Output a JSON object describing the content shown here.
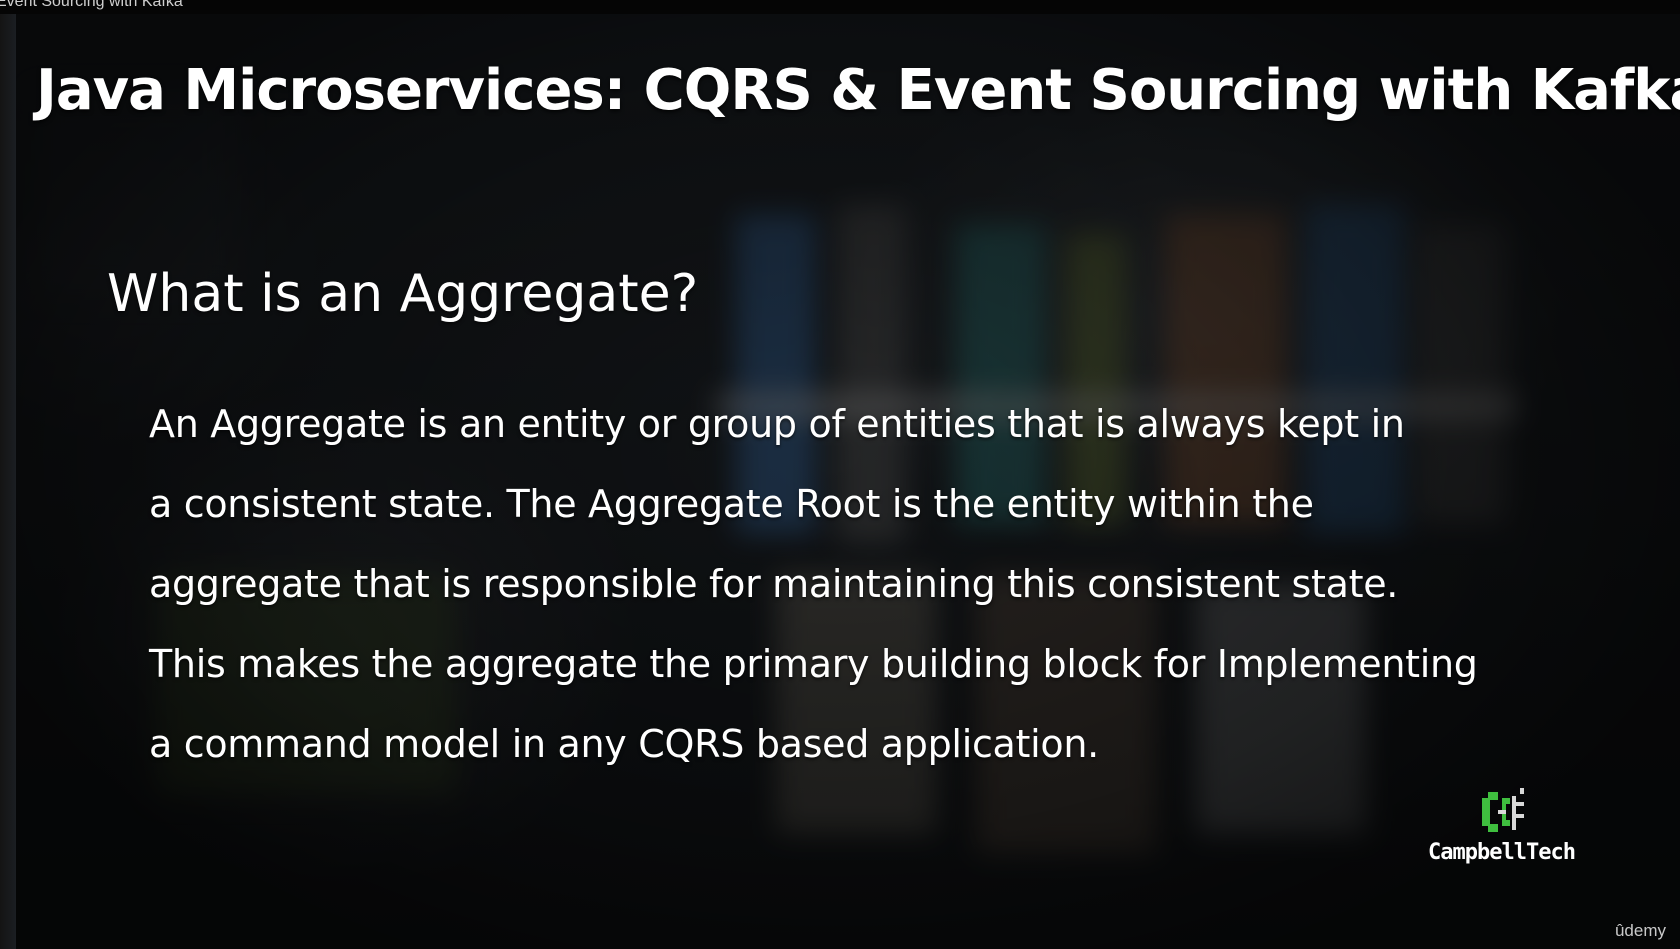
{
  "window": {
    "title": "Event Sourcing with Kafka"
  },
  "slide": {
    "course_title": "Java Microservices: CQRS & Event Sourcing with Kafka",
    "heading": "What is an Aggregate?",
    "body_lines": [
      "An Aggregate is an entity or group of entities that is always kept in",
      "a consistent state. The Aggregate Root is the entity within the",
      "aggregate that is responsible for maintaining this consistent state.",
      "This makes the aggregate the primary building block for Implementing",
      "a command model in any CQRS based application."
    ]
  },
  "branding": {
    "logo_icon": "campbelltech-logo-icon",
    "name": "CampbellTech",
    "platform": "ûdemy",
    "accent_color": "#3fbf3f"
  },
  "colors": {
    "text": "#ffffff",
    "background": "#1a1e22"
  }
}
